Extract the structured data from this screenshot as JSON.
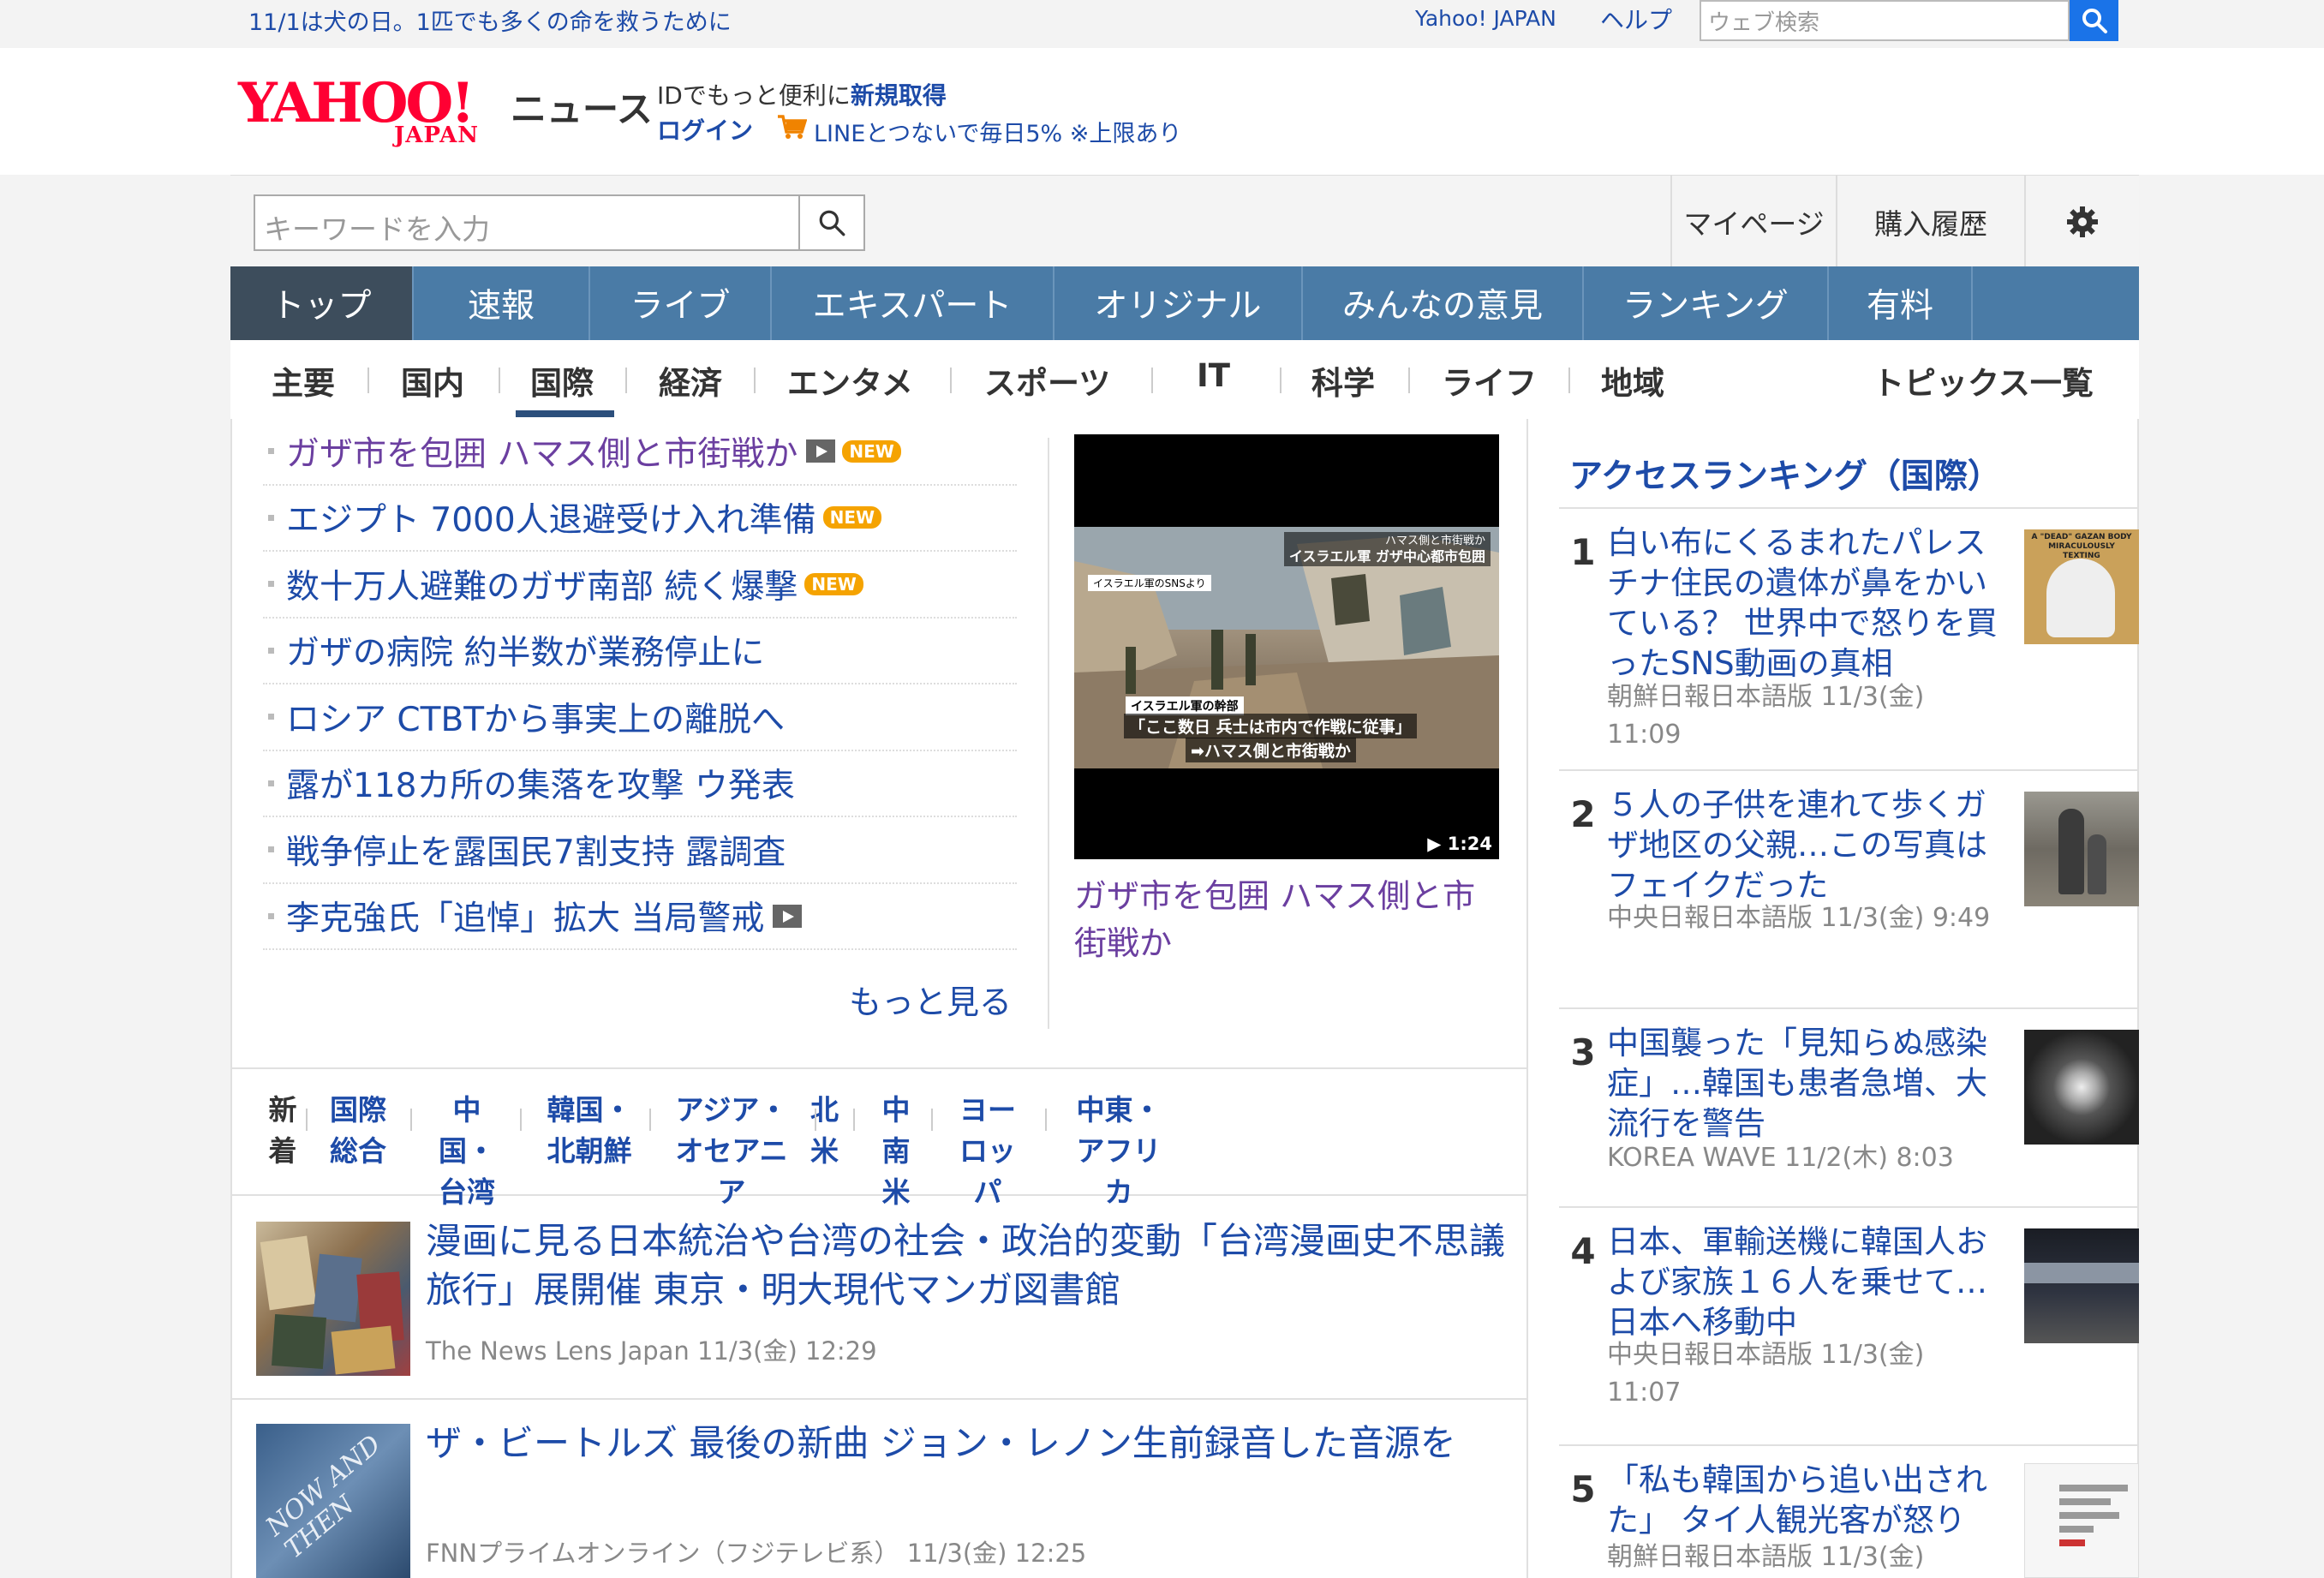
{
  "topbar": {
    "promo": "11/1は犬の日。1匹でも多くの命を救うために",
    "yahoo_japan_link": "Yahoo! JAPAN",
    "help_link": "ヘルプ",
    "web_search_placeholder": "ウェブ検索"
  },
  "header": {
    "logo_main": "YAHOO!",
    "logo_sub": "JAPAN",
    "logo_section": "ニュース",
    "id_text": "IDでもっと便利に",
    "signup_link": "新規取得",
    "login_link": "ログイン",
    "line_link": "LINEとつないで毎日5% ※上限あり"
  },
  "search": {
    "keyword_placeholder": "キーワードを入力",
    "mypage": "マイページ",
    "history": "購入履歴"
  },
  "main_nav": [
    {
      "label": "トップ",
      "active": true
    },
    {
      "label": "速報"
    },
    {
      "label": "ライブ"
    },
    {
      "label": "エキスパート"
    },
    {
      "label": "オリジナル"
    },
    {
      "label": "みんなの意見"
    },
    {
      "label": "ランキング"
    },
    {
      "label": "有料"
    }
  ],
  "sub_nav": [
    "主要",
    "国内",
    "国際",
    "経済",
    "エンタメ",
    "スポーツ",
    "IT",
    "科学",
    "ライフ",
    "地域",
    "トピックス一覧"
  ],
  "topics": [
    {
      "title": "ガザ市を包囲 ハマス側と市街戦か",
      "visited": true,
      "video": true,
      "new": true
    },
    {
      "title": "エジプト 7000人退避受け入れ準備",
      "new": true
    },
    {
      "title": "数十万人避難のガザ南部 続く爆撃",
      "new": true
    },
    {
      "title": "ガザの病院 約半数が業務停止に"
    },
    {
      "title": "ロシア CTBTから事実上の離脱へ"
    },
    {
      "title": "露が118カ所の集落を攻撃 ウ発表"
    },
    {
      "title": "戦争停止を露国民7割支持 露調査"
    },
    {
      "title": "李克強氏「追悼」拡大 当局警戒",
      "video": true
    }
  ],
  "badges": {
    "new": "NEW"
  },
  "more_link": "もっと見る",
  "video": {
    "overlay_top1": "ハマス側と市街戦か",
    "overlay_top2": "イスラエル軍 ガザ中心都市包囲",
    "overlay_source": "イスラエル軍のSNSより",
    "overlay_speaker": "イスラエル軍の幹部",
    "overlay_quote": "「ここ数日 兵士は市内で作戦に従事」",
    "overlay_arrow": "➡ハマス側と市街戦か",
    "duration": "▶ 1:24",
    "caption": "ガザ市を包囲 ハマス側と市街戦か"
  },
  "region_tabs": [
    {
      "label": "新着",
      "current": true
    },
    {
      "label": "国際総合"
    },
    {
      "label": "中国・台湾"
    },
    {
      "label": "韓国・北朝鮮"
    },
    {
      "label": "アジア・オセアニア"
    },
    {
      "label": "北米"
    },
    {
      "label": "中南米"
    },
    {
      "label": "ヨーロッパ"
    },
    {
      "label": "中東・アフリカ"
    }
  ],
  "articles": [
    {
      "title": "漫画に見る日本統治や台湾の社会・政治的変動「台湾漫画史不思議旅行」展開催 東京・明大現代マンガ図書館",
      "meta": "The News Lens Japan 11/3(金) 12:29"
    },
    {
      "title": "ザ・ビートルズ 最後の新曲 ジョン・レノン生前録音した音源を",
      "meta": "FNNプライムオンライン（フジテレビ系） 11/3(金) 12:25",
      "thumb_text": "NOW AND THEN"
    }
  ],
  "ranking": {
    "title": "アクセスランキング（国際）",
    "items": [
      {
        "rank": "1",
        "title": "白い布にくるまれたパレスチナ住民の遺体が鼻をかいている？ 世界中で怒りを買ったSNS動画の真相",
        "meta": "朝鮮日報日本語版 11/3(金) 11:09",
        "thumb_text": "A \"DEAD\" GAZAN BODY MIRACULOUSLY TEXTING"
      },
      {
        "rank": "2",
        "title": "５人の子供を連れて歩くガザ地区の父親…この写真はフェイクだった",
        "meta": "中央日報日本語版 11/3(金) 9:49"
      },
      {
        "rank": "3",
        "title": "中国襲った「見知らぬ感染症」…韓国も患者急増、大流行を警告",
        "meta": "KOREA WAVE 11/2(木) 8:03"
      },
      {
        "rank": "4",
        "title": "日本、軍輸送機に韓国人および家族１６人を乗せて…日本へ移動中",
        "meta": "中央日報日本語版 11/3(金) 11:07"
      },
      {
        "rank": "5",
        "title": "「私も韓国から追い出された」 タイ人観光客が怒り",
        "meta": "朝鮮日報日本語版 11/3(金)"
      }
    ]
  },
  "colors": {
    "nav_bg": "#4a7ba6",
    "nav_active": "#3d4d5c",
    "link": "#1d4ba8",
    "visited": "#6b3fa0",
    "new_badge": "#f5a300",
    "logo_red": "#ff0033"
  }
}
